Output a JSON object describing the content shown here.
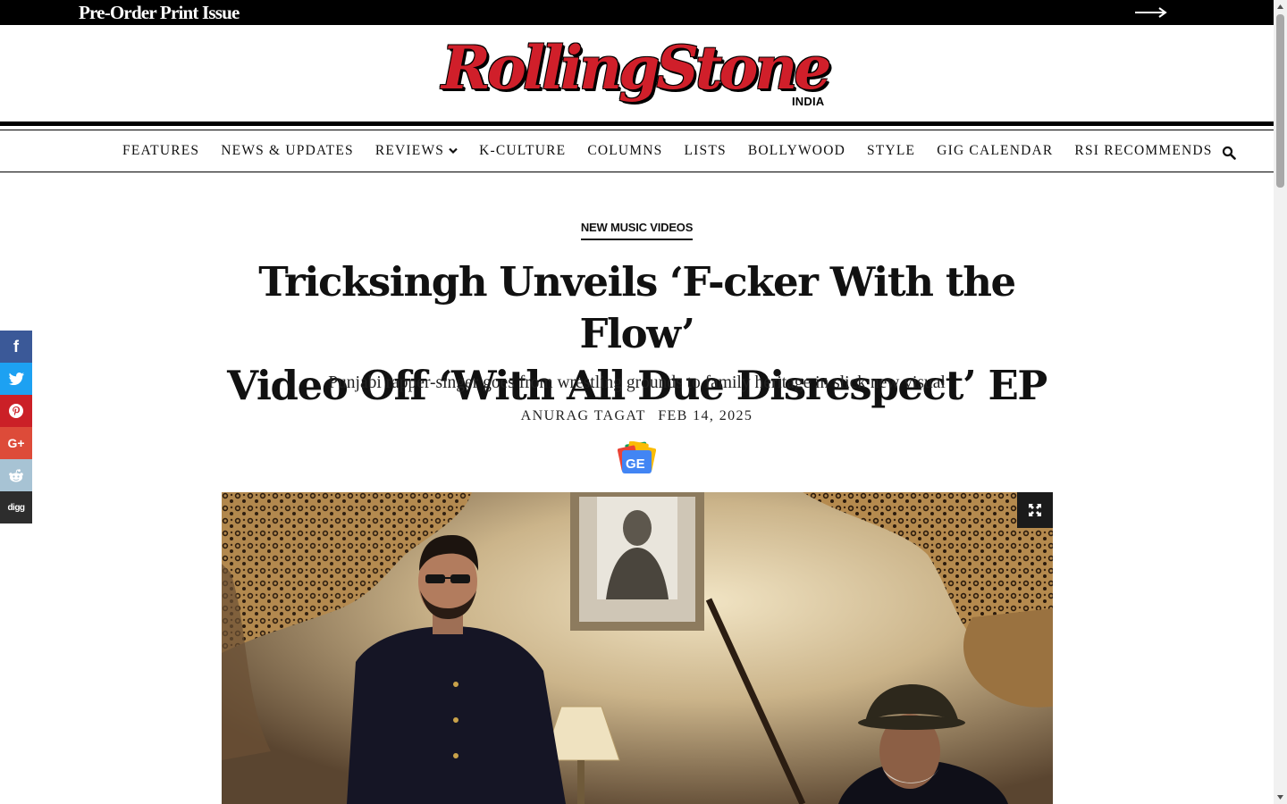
{
  "promo": {
    "text": "Pre-Order Print Issue"
  },
  "brand": {
    "name": "RollingStone",
    "region": "INDIA",
    "accent": "#d01f2a"
  },
  "nav": {
    "items": [
      {
        "label": "FEATURES"
      },
      {
        "label": "NEWS & UPDATES"
      },
      {
        "label": "REVIEWS",
        "has_dropdown": true
      },
      {
        "label": "K-CULTURE"
      },
      {
        "label": "COLUMNS"
      },
      {
        "label": "LISTS"
      },
      {
        "label": "BOLLYWOOD"
      },
      {
        "label": "STYLE"
      },
      {
        "label": "GIG CALENDAR"
      },
      {
        "label": "RSI RECOMMENDS"
      }
    ],
    "search_icon": "search-icon"
  },
  "article": {
    "category": "NEW MUSIC VIDEOS",
    "headline_line1": "Tricksingh Unveils ‘F-cker With the Flow’",
    "headline_line2": "Video Off ‘With All Due Disrespect’ EP",
    "subhead": "Punjabi rapper-singer goes from wrestling grounds to family heritage in slick new visual",
    "author": "ANURAG TAGAT",
    "date": "FEB 14, 2025",
    "google_news_label": "GE"
  },
  "social": {
    "facebook": "f",
    "googleplus": "G+",
    "digg": "digg"
  }
}
